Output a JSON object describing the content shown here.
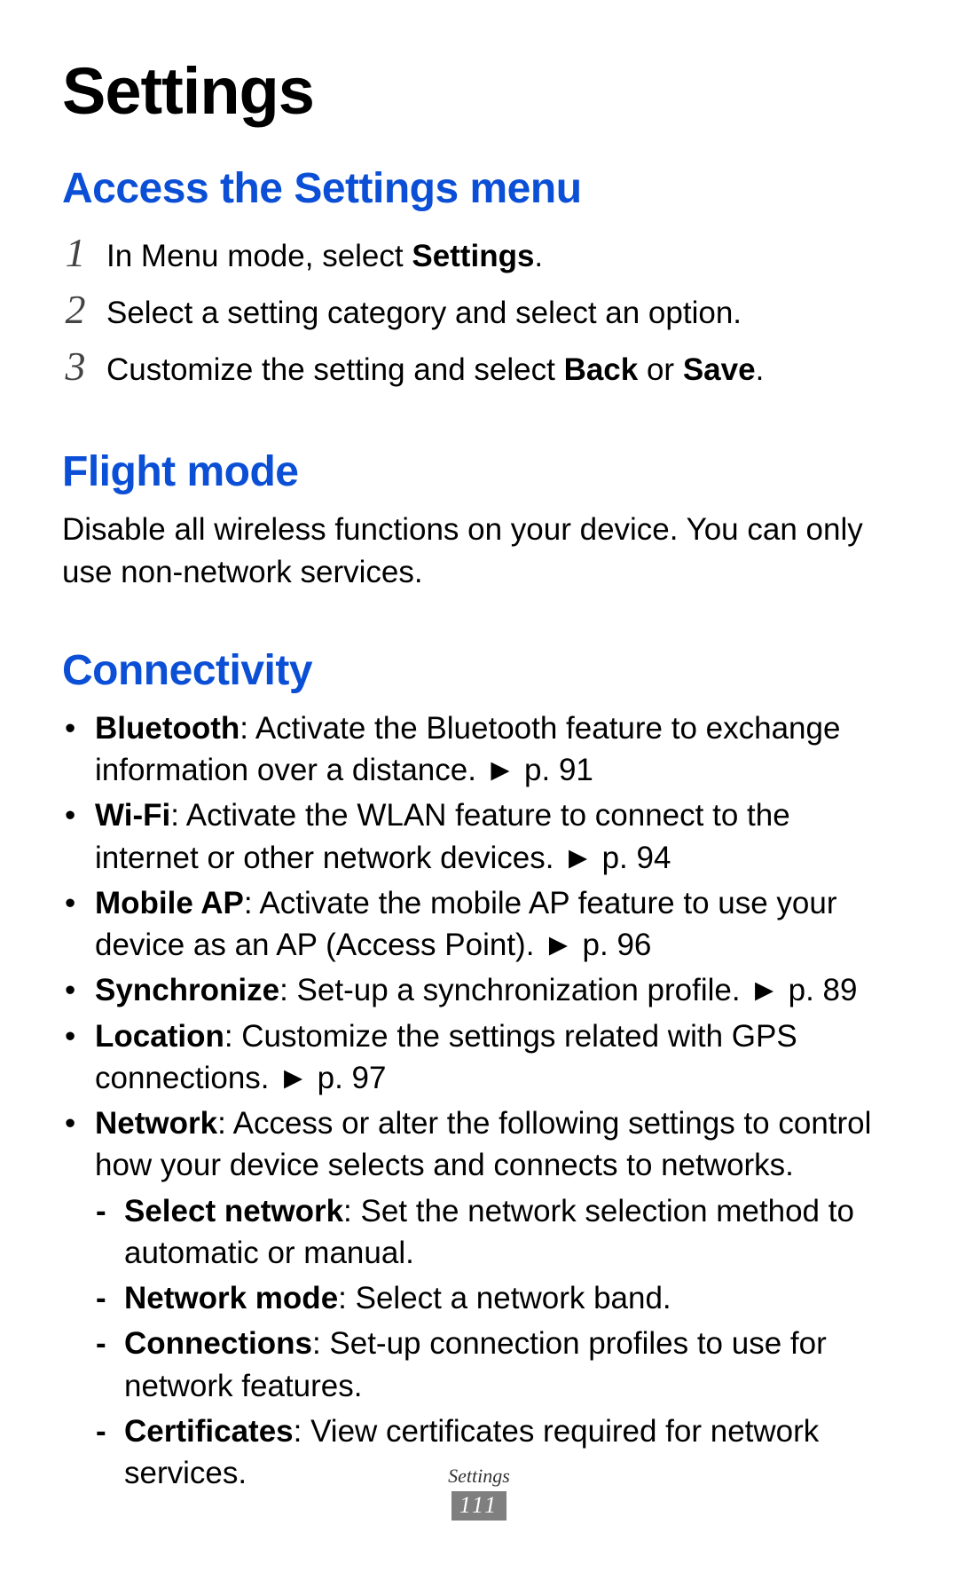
{
  "title": "Settings",
  "sections": {
    "access": {
      "heading": "Access the Settings menu",
      "steps": [
        {
          "num": "1",
          "pre": "In Menu mode, select ",
          "bold": "Settings",
          "post": "."
        },
        {
          "num": "2",
          "pre": "Select a setting category and select an option.",
          "bold": "",
          "post": ""
        },
        {
          "num": "3",
          "pre": "Customize the setting and select ",
          "bold": "Back",
          "mid": " or ",
          "bold2": "Save",
          "post": "."
        }
      ]
    },
    "flight": {
      "heading": "Flight mode",
      "body": "Disable all wireless functions on your device. You can only use non-network services."
    },
    "connectivity": {
      "heading": "Connectivity",
      "bullets": [
        {
          "label": "Bluetooth",
          "text": ": Activate the Bluetooth feature to exchange information over a distance. ► p. 91"
        },
        {
          "label": "Wi-Fi",
          "text": ": Activate the WLAN feature to connect to the internet or other network devices. ► p. 94"
        },
        {
          "label": "Mobile AP",
          "text": ": Activate the mobile AP feature to use your device as an AP (Access Point). ► p. 96"
        },
        {
          "label": "Synchronize",
          "text": ": Set-up a synchronization profile. ► p. 89"
        },
        {
          "label": "Location",
          "text": ": Customize the settings related with GPS connections. ► p. 97"
        },
        {
          "label": "Network",
          "text": ": Access or alter the following settings to control how your device selects and connects to networks."
        }
      ],
      "network_sub": [
        {
          "label": "Select network",
          "text": ": Set the network selection method to automatic or manual."
        },
        {
          "label": "Network mode",
          "text": ": Select a network band."
        },
        {
          "label": "Connections",
          "text": ": Set-up connection profiles to use for network features."
        },
        {
          "label": "Certificates",
          "text": ": View certificates required for network services."
        }
      ]
    }
  },
  "footer": {
    "label": "Settings",
    "page": "111"
  }
}
